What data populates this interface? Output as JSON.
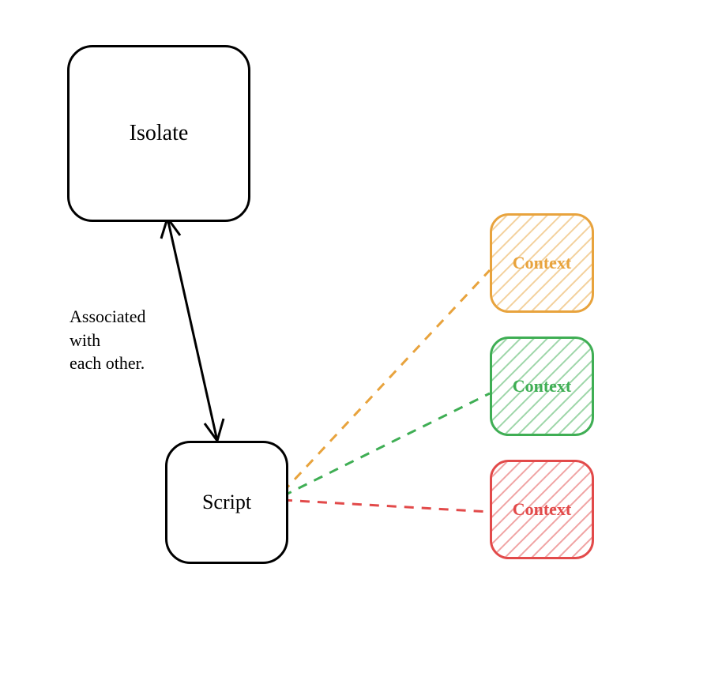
{
  "nodes": {
    "isolate": {
      "label": "Isolate"
    },
    "script": {
      "label": "Script"
    },
    "contexts": [
      {
        "label": "Context",
        "color": "#e8a33d",
        "fill": "#f7e3c1"
      },
      {
        "label": "Context",
        "color": "#3fae54",
        "fill": "#cdeccf"
      },
      {
        "label": "Context",
        "color": "#e24a4a",
        "fill": "#f6cfcf"
      }
    ]
  },
  "edge_label": "Associated\nwith\neach other.",
  "colors": {
    "black": "#000000",
    "orange": "#e8a33d",
    "green": "#3fae54",
    "red": "#e24a4a"
  }
}
